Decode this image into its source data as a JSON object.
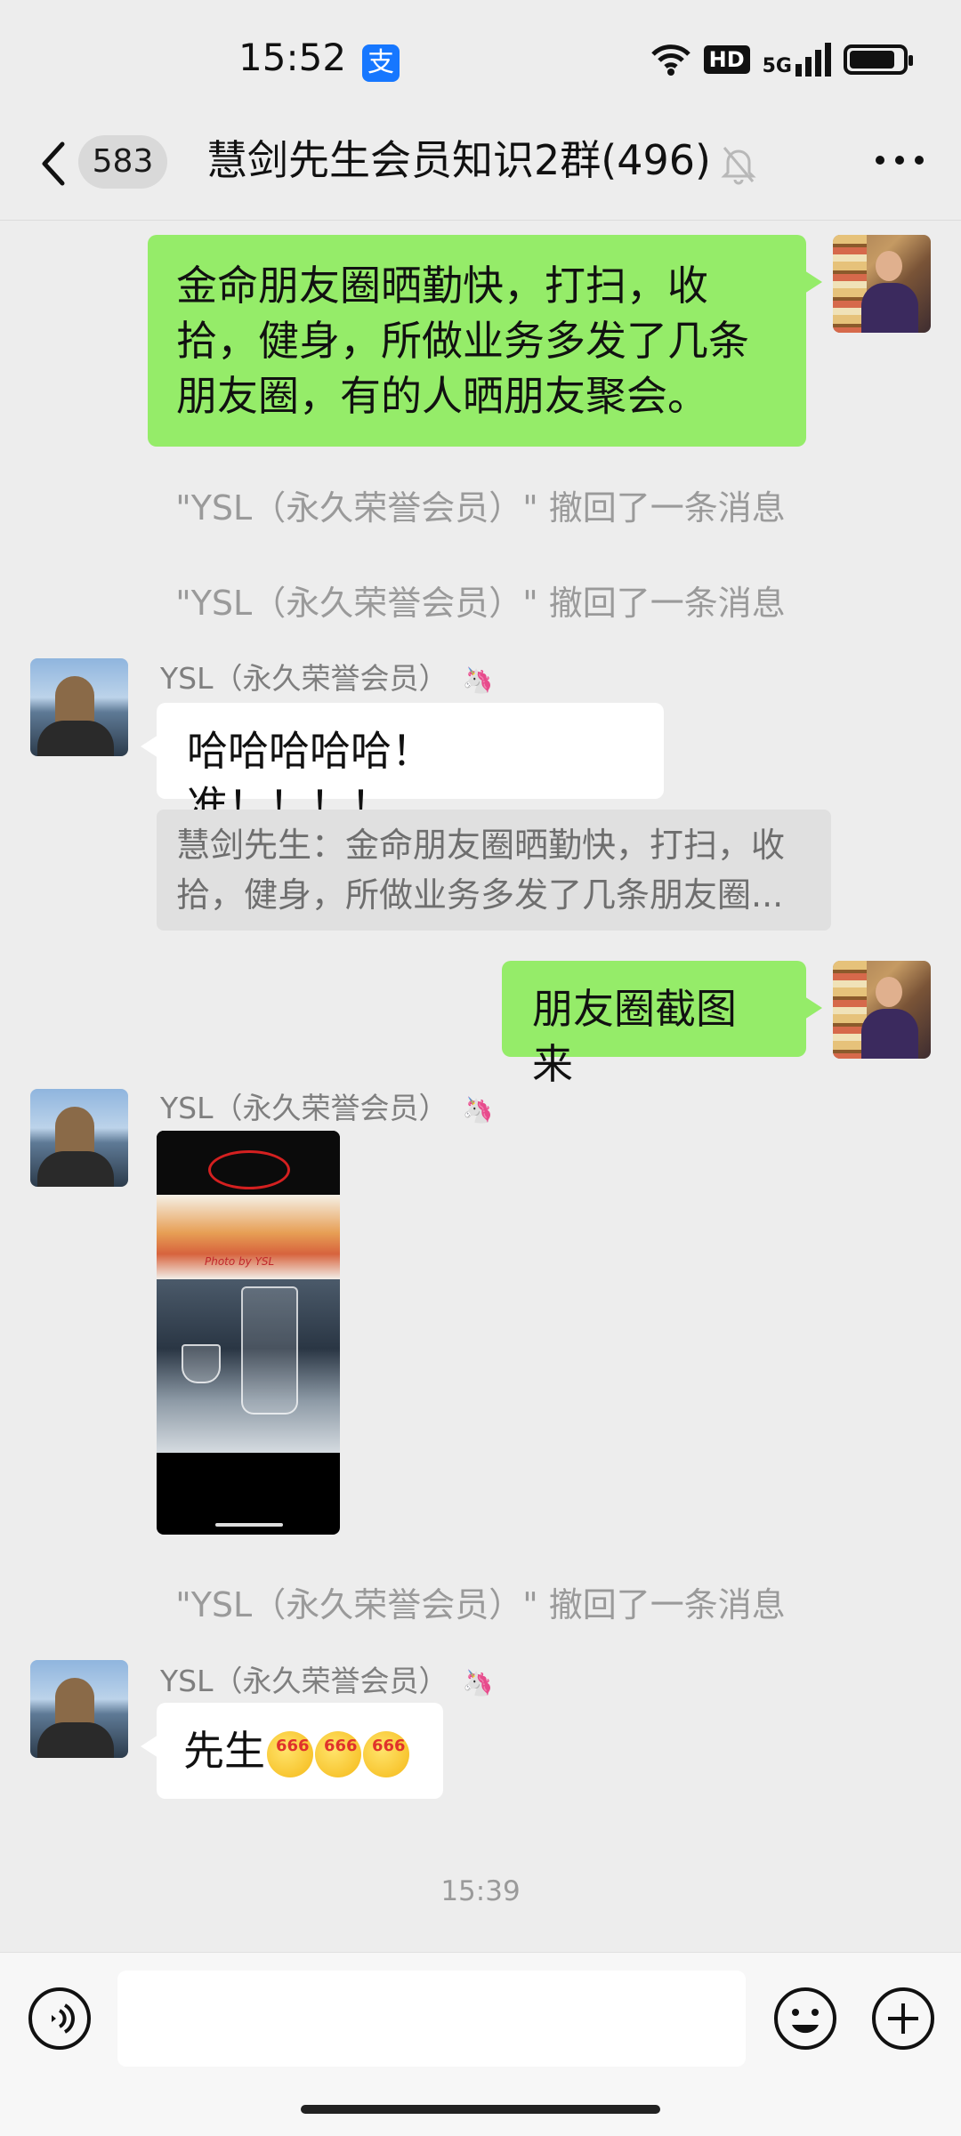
{
  "status_bar": {
    "time": "15:52",
    "alipay_icon_label": "支",
    "hd": "HD",
    "network": "5G",
    "battery_percent": 90
  },
  "nav": {
    "unread_count": "583",
    "title": "慧剑先生会员知识2群(496)"
  },
  "messages": {
    "m1": {
      "text": "金命朋友圈晒勤快，打扫，收拾，健身，所做业务多发了几条朋友圈，有的人晒朋友聚会。"
    },
    "recall_1": "\"YSL（永久荣誉会员）\" 撤回了一条消息",
    "recall_2": "\"YSL（永久荣誉会员）\" 撤回了一条消息",
    "m2": {
      "sender": "YSL（永久荣誉会员）",
      "text": "哈哈哈哈哈！准！！！！",
      "quote": "慧剑先生：金命朋友圈晒勤快，打扫，收拾，健身，所做业务多发了几条朋友圈..."
    },
    "m3": {
      "text": "朋友圈截图来"
    },
    "m4": {
      "sender": "YSL（永久荣誉会员）",
      "image_caption": "Photo by YSL"
    },
    "recall_3": "\"YSL（永久荣誉会员）\" 撤回了一条消息",
    "m5": {
      "sender": "YSL（永久荣誉会员）",
      "text": "先生",
      "emoji_badge": "666"
    }
  },
  "time_divider": "15:39",
  "input": {
    "value": "",
    "placeholder": ""
  },
  "icons": [
    "back-chevron-icon",
    "mute-bell-icon",
    "more-dots-icon",
    "voice-icon",
    "emoji-icon",
    "plus-icon",
    "unicorn-badge-icon"
  ],
  "colors": {
    "my_bubble": "#95ec69",
    "other_bubble": "#ffffff",
    "background": "#ededed",
    "alipay_blue": "#1677ff"
  }
}
